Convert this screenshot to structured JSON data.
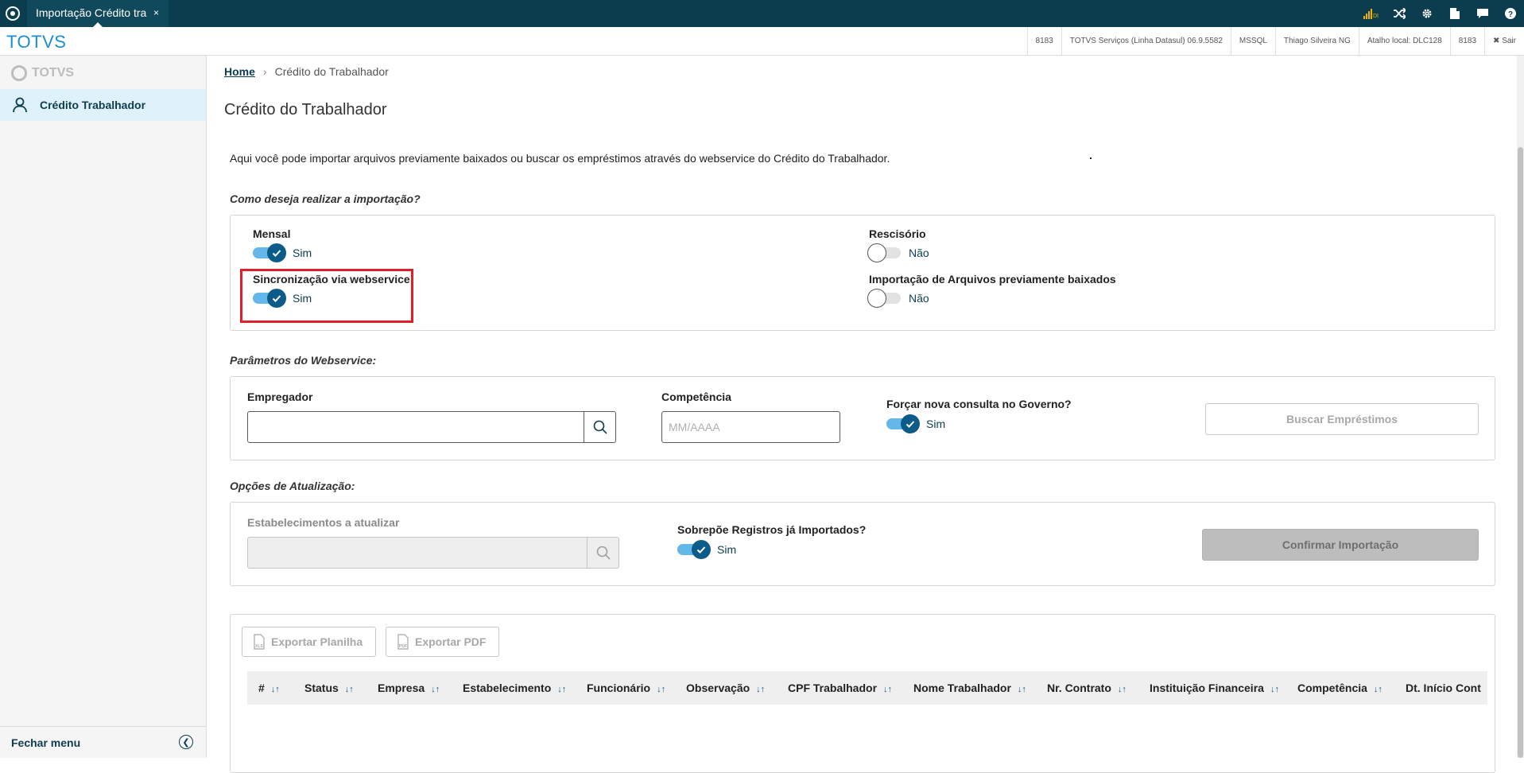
{
  "topbar": {
    "tab_title": "Importação Crédito tra",
    "tab_close": "×",
    "icons": [
      "signal-icon",
      "shuffle-icon",
      "gear-icon",
      "document-icon",
      "chat-icon",
      "help-icon"
    ]
  },
  "brandbar": {
    "brand": "TOTVS",
    "status": [
      "8183",
      "TOTVS Serviços (Linha Datasul) 06.9.5582",
      "MSSQL",
      "Thiago Silveira NG",
      "Atalho local: DLC128",
      "8183",
      "✖ Sair"
    ]
  },
  "sidebar": {
    "logo": "TOTVS",
    "item": "Crédito Trabalhador",
    "footer": "Fechar menu"
  },
  "breadcrumb": {
    "home": "Home",
    "current": "Crédito do Trabalhador"
  },
  "page_title": "Crédito do Trabalhador",
  "intro": "Aqui você pode importar arquivos previamente baixados ou buscar os empréstimos através do webservice do Crédito do Trabalhador.",
  "import_section": {
    "label": "Como deseja realizar a importação?",
    "mensal": {
      "label": "Mensal",
      "value": "Sim"
    },
    "rescisorio": {
      "label": "Rescisório",
      "value": "Não"
    },
    "sincronizacao": {
      "label": "Sincronização via webservice",
      "value": "Sim"
    },
    "arquivos": {
      "label": "Importação de Arquivos previamente baixados",
      "value": "Não"
    }
  },
  "webservice_section": {
    "label": "Parâmetros do Webservice:",
    "empregador_label": "Empregador",
    "competencia_label": "Competência",
    "competencia_placeholder": "MM/AAAA",
    "forcar_label": "Forçar nova consulta no Governo?",
    "forcar_value": "Sim",
    "buscar_button": "Buscar Empréstimos"
  },
  "update_section": {
    "label": "Opções de Atualização:",
    "estab_label": "Estabelecimentos a atualizar",
    "sobrepoe_label": "Sobrepõe Registros já Importados?",
    "sobrepoe_value": "Sim",
    "confirm_button": "Confirmar Importação"
  },
  "grid": {
    "export_xls": "Exportar Planilha",
    "export_pdf": "Exportar PDF",
    "xls_tag": "XLS",
    "pdf_tag": "PDF",
    "sort_glyph": "↓↑",
    "columns": [
      "#",
      "Status",
      "Empresa",
      "Estabelecimento",
      "Funcionário",
      "Observação",
      "CPF Trabalhador",
      "Nome Trabalhador",
      "Nr. Contrato",
      "Instituição Financeira",
      "Competência",
      "Dt. Início Cont"
    ]
  },
  "colors": {
    "topbar": "#0c3d4e",
    "brand": "#1a8fd0",
    "toggle_on": "#0b5c89",
    "highlight": "#e01f2a"
  }
}
